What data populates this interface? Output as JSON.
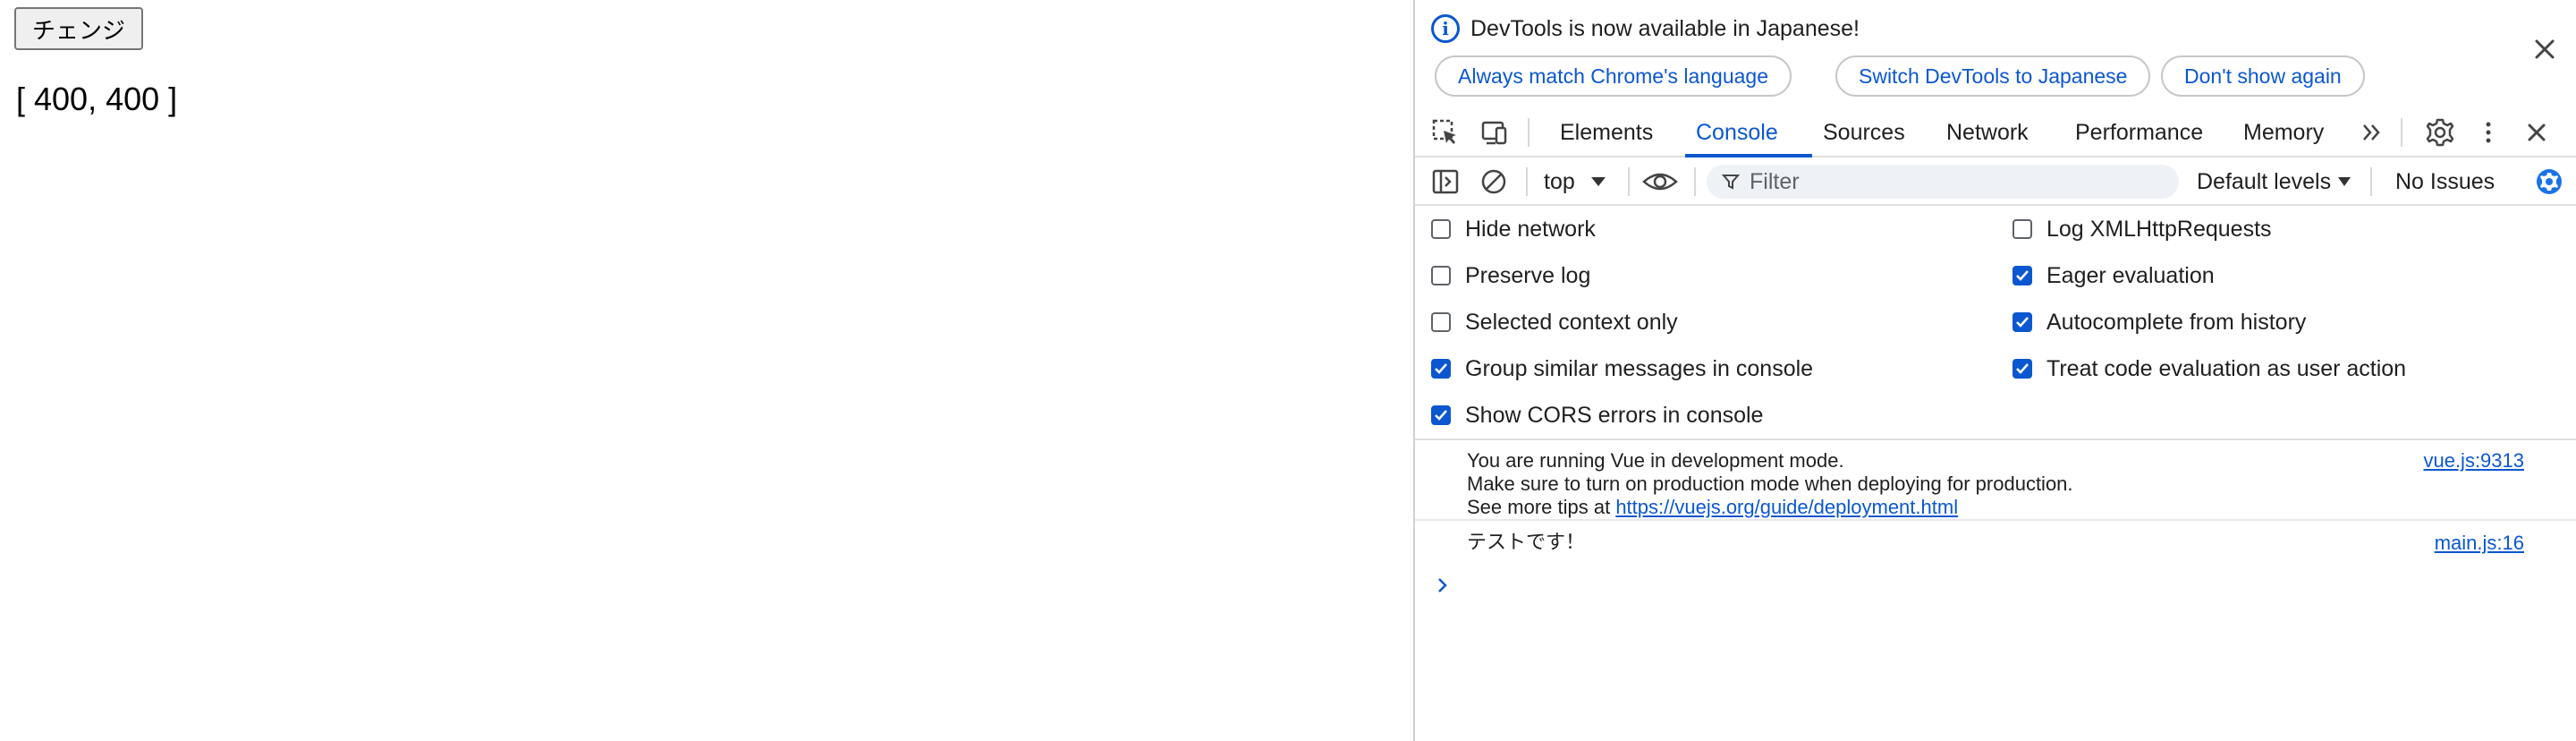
{
  "page": {
    "button_label": "チェンジ",
    "array_text": "[ 400, 400 ]"
  },
  "infobar": {
    "message": "DevTools is now available in Japanese!",
    "buttons": [
      "Always match Chrome's language",
      "Switch DevTools to Japanese",
      "Don't show again"
    ]
  },
  "tabs": [
    "Elements",
    "Console",
    "Sources",
    "Network",
    "Performance",
    "Memory"
  ],
  "active_tab": "Console",
  "console_toolbar": {
    "context": "top",
    "filter_placeholder": "Filter",
    "levels": "Default levels",
    "issues": "No Issues"
  },
  "settings_left": [
    {
      "label": "Hide network",
      "checked": false
    },
    {
      "label": "Preserve log",
      "checked": false
    },
    {
      "label": "Selected context only",
      "checked": false
    },
    {
      "label": "Group similar messages in console",
      "checked": true
    },
    {
      "label": "Show CORS errors in console",
      "checked": true
    }
  ],
  "settings_right": [
    {
      "label": "Log XMLHttpRequests",
      "checked": false
    },
    {
      "label": "Eager evaluation",
      "checked": true
    },
    {
      "label": "Autocomplete from history",
      "checked": true
    },
    {
      "label": "Treat code evaluation as user action",
      "checked": true
    }
  ],
  "messages": [
    {
      "lines": [
        "You are running Vue in development mode.",
        "Make sure to turn on production mode when deploying for production."
      ],
      "tip_prefix": "See more tips at ",
      "tip_link": "https://vuejs.org/guide/deployment.html",
      "source": "vue.js:9313"
    },
    {
      "text": "テストです！",
      "source": "main.js:16"
    }
  ],
  "colors": {
    "accent": "#0b57d0",
    "settings_gear": "#1a73e8"
  }
}
